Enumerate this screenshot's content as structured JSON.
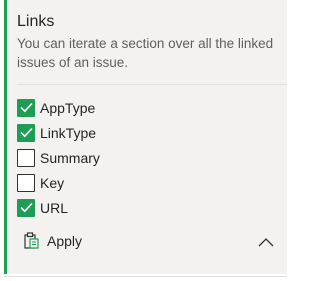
{
  "section": {
    "title": "Links",
    "description": "You can iterate a section over all the linked issues of an issue."
  },
  "options": [
    {
      "label": "AppType",
      "checked": true
    },
    {
      "label": "LinkType",
      "checked": true
    },
    {
      "label": "Summary",
      "checked": false
    },
    {
      "label": "Key",
      "checked": false
    },
    {
      "label": "URL",
      "checked": true
    }
  ],
  "actions": {
    "apply_label": "Apply",
    "apply_icon": "clipboard-icon",
    "collapse_icon": "chevron-up-icon"
  },
  "colors": {
    "accent": "#1e9e54",
    "panel_bg": "#f3f2f1",
    "text": "#252423",
    "muted_text": "#605e5c"
  }
}
